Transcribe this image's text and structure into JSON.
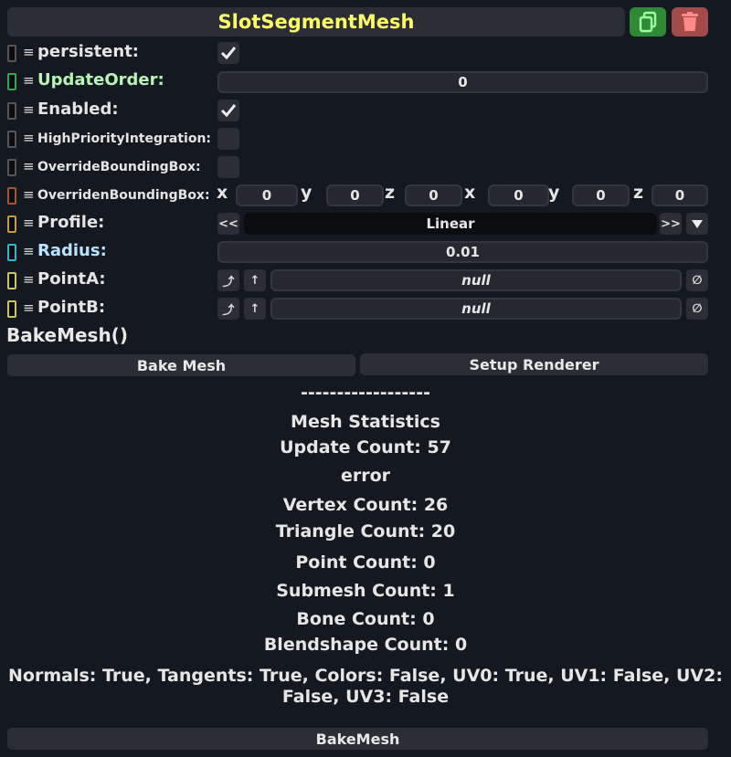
{
  "header": {
    "title": "SlotSegmentMesh",
    "duplicate_icon": "copy-icon",
    "delete_icon": "trash-icon"
  },
  "fields": {
    "persistent": {
      "label": "persistent:",
      "checked": true
    },
    "update_order": {
      "label": "UpdateOrder:",
      "value": "0"
    },
    "enabled": {
      "label": "Enabled:",
      "checked": true
    },
    "high_priority": {
      "label": "HighPriorityIntegration:",
      "checked": false
    },
    "override_bbox": {
      "label": "OverrideBoundingBox:",
      "checked": false
    },
    "overriden_bbox": {
      "label": "OverridenBoundingBox:",
      "axes": [
        "x",
        "y",
        "z",
        "x",
        "y",
        "z"
      ],
      "values": [
        "0",
        "0",
        "0",
        "0",
        "0",
        "0"
      ]
    },
    "profile": {
      "label": "Profile:",
      "value": "Linear",
      "prev": "<<",
      "next": ">>"
    },
    "radius": {
      "label": "Radius:",
      "value": "0.01"
    },
    "point_a": {
      "label": "PointA:",
      "value": "null"
    },
    "point_b": {
      "label": "PointB:",
      "value": "null"
    }
  },
  "method": {
    "label": "BakeMesh()"
  },
  "buttons": {
    "bake_mesh": "Bake Mesh",
    "setup_renderer": "Setup Renderer",
    "bake_mesh_bottom": "BakeMesh"
  },
  "stats": {
    "divider": "------------------",
    "title": "Mesh Statistics",
    "update_count": "Update Count: 57",
    "error": "error",
    "vertex_count": "Vertex Count: 26",
    "triangle_count": "Triangle Count: 20",
    "point_count": "Point Count: 0",
    "submesh_count": "Submesh Count: 1",
    "bone_count": "Bone Count: 0",
    "blendshape_count": "Blendshape Count: 0",
    "attributes_line1": "Normals: True, Tangents: True, Colors: False, UV0: True, UV1: False, UV2:",
    "attributes_line2": "False, UV3: False"
  },
  "colors": {
    "background": "#141820",
    "title": "#ffff66",
    "duplicate_button": "#2f8a36",
    "delete_button": "#a34a4a"
  }
}
